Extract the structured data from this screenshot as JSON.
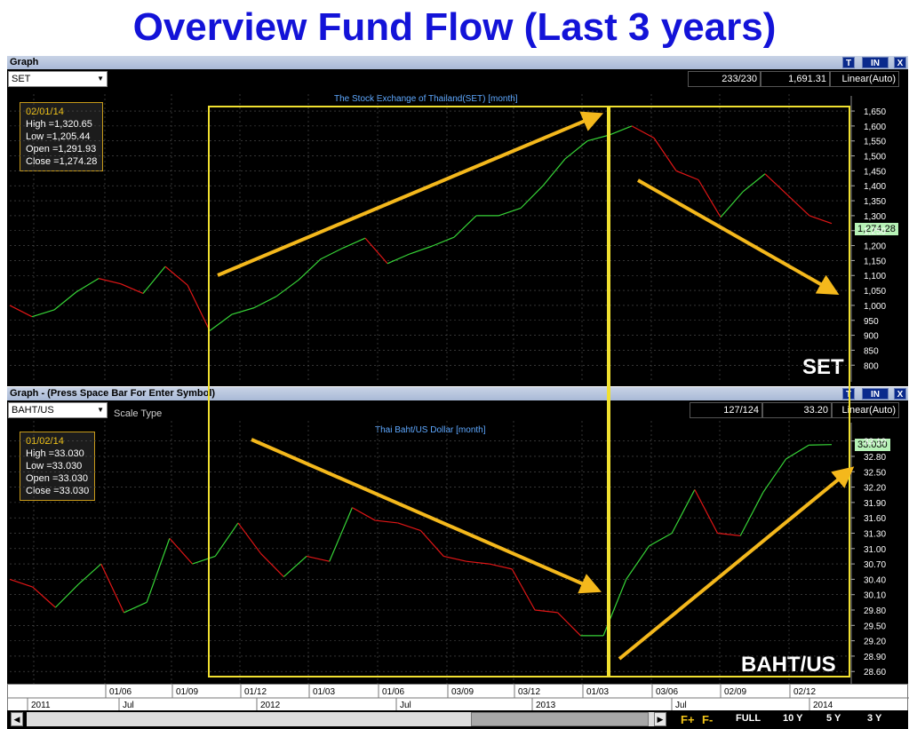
{
  "page_title": "Overview Fund Flow (Last 3 years)",
  "colors": {
    "up": "#37d437",
    "down": "#e01616",
    "annot": "#f4b81c",
    "box": "#f0e030",
    "grid": "#555555"
  },
  "top_window": {
    "title": "Graph",
    "buttons": [
      "T",
      "IN",
      "X"
    ],
    "symbol": "SET",
    "count": "233/230",
    "last": "1,691.31",
    "scale": "Linear(Auto)",
    "chart_title": "The Stock Exchange of Thailand(SET) [month]",
    "info": {
      "date": "02/01/14",
      "high": "High  =1,320.65",
      "low": "Low   =1,205.44",
      "open": "Open  =1,291.93",
      "close": "Close  =1,274.28"
    },
    "price_tag": "1,274.28",
    "watermark": "SET"
  },
  "bottom_window": {
    "title": "Graph  - (Press Space Bar For Enter Symbol)",
    "buttons": [
      "T",
      "IN",
      "X"
    ],
    "symbol": "BAHT/US",
    "scale_type": "Scale Type",
    "count": "127/124",
    "last": "33.20",
    "scale": "Linear(Auto)",
    "chart_title": "Thai Baht/US Dollar [month]",
    "info": {
      "date": "01/02/14",
      "high": "High  =33.030",
      "low": "Low   =33.030",
      "open": "Open  =33.030",
      "close": "Close  =33.030"
    },
    "price_tag": "33.030",
    "watermark": "BAHT/US"
  },
  "time_axis": {
    "top_labels": [
      "01/06",
      "01/09",
      "01/12",
      "01/03",
      "01/06",
      "03/09",
      "03/12",
      "01/03",
      "03/06",
      "02/09",
      "02/12"
    ],
    "bottom_labels": [
      "2011",
      "Jul",
      "2012",
      "Jul",
      "2013",
      "Jul",
      "2014"
    ]
  },
  "bottom_bar": {
    "f_plus": "F+",
    "f_minus": "F-",
    "buttons": [
      "FULL",
      "10 Y",
      "5 Y",
      "3 Y"
    ]
  },
  "chart_data": [
    {
      "type": "line",
      "title": "The Stock Exchange of Thailand(SET) [month]",
      "ylim": [
        780,
        1665
      ],
      "yticks": [
        800,
        850,
        900,
        950,
        1000,
        1050,
        1100,
        1150,
        1200,
        1250,
        1300,
        1350,
        1400,
        1450,
        1500,
        1550,
        1600,
        1650
      ],
      "ytick_labels": [
        "800",
        "850",
        "900",
        "950",
        "1,000",
        "1,050",
        "1,100",
        "1,150",
        "1,200",
        "1,250",
        "1,300",
        "1,350",
        "1,400",
        "1,450",
        "1,500",
        "1,550",
        "1,600",
        "1,650"
      ],
      "values": [
        1000,
        962,
        985,
        1045,
        1090,
        1072,
        1040,
        1130,
        1068,
        915,
        970,
        992,
        1030,
        1085,
        1155,
        1192,
        1225,
        1140,
        1172,
        1198,
        1228,
        1300,
        1300,
        1325,
        1400,
        1490,
        1550,
        1570,
        1600,
        1560,
        1450,
        1420,
        1295,
        1380,
        1440,
        1370,
        1300,
        1274
      ]
    },
    {
      "type": "line",
      "title": "Thai Baht/US Dollar [month]",
      "ylim": [
        28.5,
        33.25
      ],
      "yticks": [
        28.6,
        28.9,
        29.2,
        29.5,
        29.8,
        30.1,
        30.4,
        30.7,
        31.0,
        31.3,
        31.6,
        31.9,
        32.2,
        32.5,
        32.8,
        33.1
      ],
      "ytick_labels": [
        "28.60",
        "28.90",
        "29.20",
        "29.50",
        "29.80",
        "30.10",
        "30.40",
        "30.70",
        "31.00",
        "31.30",
        "31.60",
        "31.90",
        "32.20",
        "32.50",
        "32.80",
        "33.10"
      ],
      "values": [
        30.4,
        30.25,
        29.85,
        30.3,
        30.7,
        29.75,
        29.95,
        31.2,
        30.7,
        30.85,
        31.5,
        30.9,
        30.45,
        30.85,
        30.75,
        31.8,
        31.55,
        31.5,
        31.35,
        30.85,
        30.75,
        30.7,
        30.6,
        29.8,
        29.75,
        29.3,
        29.3,
        30.4,
        31.05,
        31.3,
        32.15,
        31.3,
        31.25,
        32.1,
        32.75,
        33.02,
        33.03
      ]
    }
  ]
}
